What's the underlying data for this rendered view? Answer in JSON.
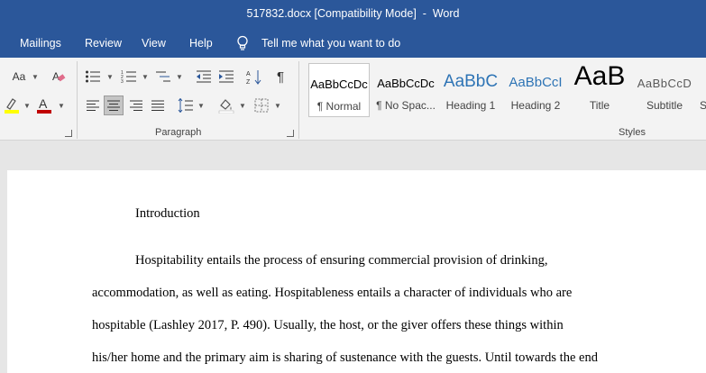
{
  "window": {
    "title": "517832.docx [Compatibility Mode]  -  Word"
  },
  "menu": {
    "tabs": [
      "Mailings",
      "Review",
      "View",
      "Help"
    ],
    "tell_me": "Tell me what you want to do"
  },
  "ribbon": {
    "font_size_label": "Aa",
    "paragraph_label": "Paragraph",
    "styles_label": "Styles",
    "styles": [
      {
        "sample": "AaBbCcDc",
        "label": "¶ Normal"
      },
      {
        "sample": "AaBbCcDc",
        "label": "¶ No Spac..."
      },
      {
        "sample": "AaBbC",
        "label": "Heading 1"
      },
      {
        "sample": "AaBbCcI",
        "label": "Heading 2"
      },
      {
        "sample": "AaB",
        "label": "Title"
      },
      {
        "sample": "AaBbCcD",
        "label": "Subtitle"
      },
      {
        "sample": "",
        "label": "S"
      }
    ],
    "colors": {
      "highlight": "#ffff00",
      "font_color": "#c00000",
      "title_blue": "#2b579a",
      "heading_blue": "#2e74b5"
    }
  },
  "document": {
    "heading": "Introduction",
    "lines": [
      "Hospitability entails the process of ensuring commercial provision of drinking,",
      "accommodation, as well as eating. Hospitableness entails a character of individuals who are",
      "hospitable (Lashley 2017, P. 490). Usually, the host, or the giver offers these things within",
      "his/her home and the primary aim is sharing of sustenance with the guests. Until towards the end"
    ]
  }
}
